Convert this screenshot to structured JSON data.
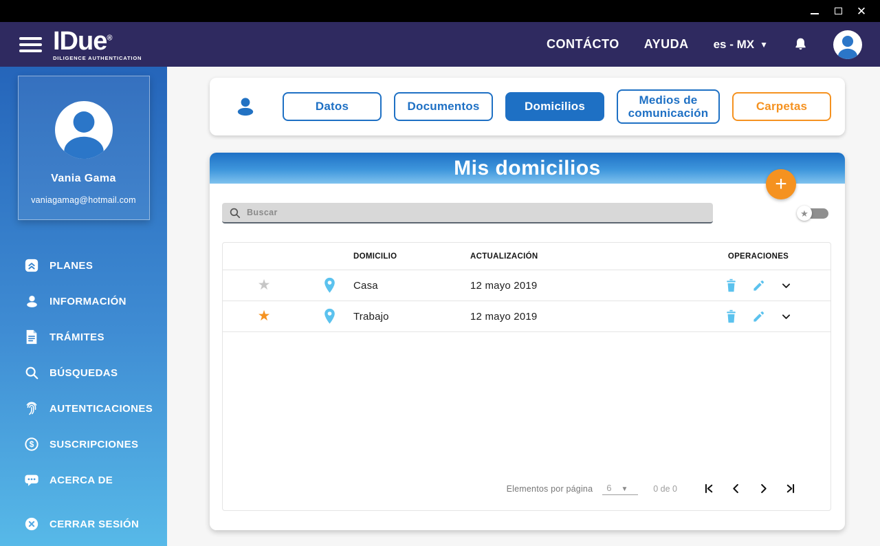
{
  "header": {
    "logo": "IDue",
    "trademark": "®",
    "tagline": "DILIGENCE AUTHENTICATION",
    "nav": {
      "contact": "CONTÁCTO",
      "help": "AYUDA"
    },
    "language": "es - MX"
  },
  "sidebar": {
    "user": {
      "name": "Vania Gama",
      "email": "vaniagamag@hotmail.com"
    },
    "items": [
      {
        "id": "planes",
        "label": "PLANES"
      },
      {
        "id": "informacion",
        "label": "INFORMACIÓN"
      },
      {
        "id": "tramites",
        "label": "TRÁMITES"
      },
      {
        "id": "busquedas",
        "label": "BÚSQUEDAS"
      },
      {
        "id": "autenticaciones",
        "label": "AUTENTICACIONES"
      },
      {
        "id": "suscripciones",
        "label": "SUSCRIPCIONES"
      },
      {
        "id": "acerca-de",
        "label": "ACERCA DE"
      }
    ],
    "logout_label": "CERRAR SESIÓN"
  },
  "tabs": {
    "items": [
      "Datos",
      "Documentos",
      "Domicilios",
      "Medios de comunicación",
      "Carpetas"
    ],
    "active": "Domicilios"
  },
  "panel": {
    "title": "Mis domicilios",
    "add_button": "+"
  },
  "search": {
    "placeholder": "Buscar"
  },
  "table": {
    "columns": [
      "DOMICILIO",
      "ACTUALIZACIÓN",
      "OPERACIONES"
    ],
    "rows": [
      {
        "favorite": false,
        "name": "Casa",
        "updated": "12 mayo 2019"
      },
      {
        "favorite": true,
        "name": "Trabajo",
        "updated": "12 mayo 2019"
      }
    ]
  },
  "pagination": {
    "items_per_page_label": "Elementos por página",
    "page_size": "6",
    "range_label": "0 de 0"
  },
  "colors": {
    "accent_blue": "#1e70c4",
    "light_blue": "#5bc2ee",
    "orange": "#f59220",
    "header_navy": "#2f2a60",
    "sidebar_top": "#2565ba",
    "sidebar_bottom": "#57b9e8"
  }
}
